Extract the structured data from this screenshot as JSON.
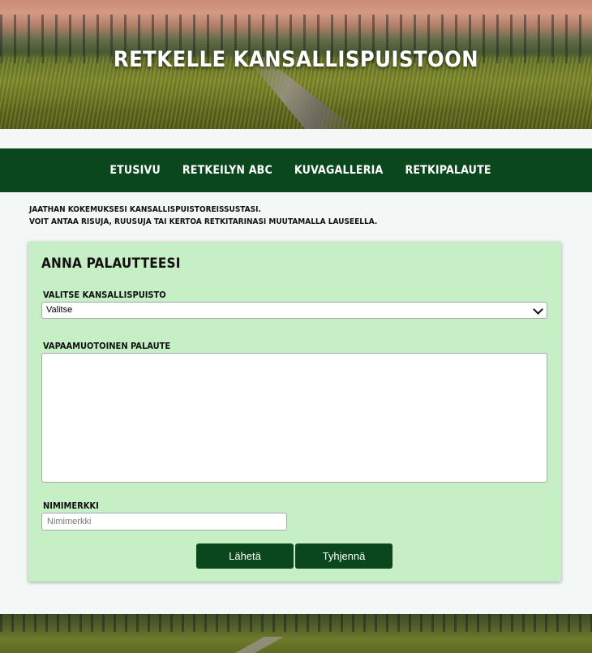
{
  "header": {
    "title": "RETKELLE KANSALLISPUISTOON"
  },
  "nav": {
    "items": [
      {
        "label": "ETUSIVU"
      },
      {
        "label": "RETKEILYN ABC"
      },
      {
        "label": "KUVAGALLERIA"
      },
      {
        "label": "RETKIPALAUTE"
      }
    ]
  },
  "intro": {
    "line1": "JAATHAN KOKEMUKSESI KANSALLISPUISTOREISSUSTASI.",
    "line2": "VOIT ANTAA RISUJA, RUUSUJA TAI KERTOA RETKITARINASI MUUTAMALLA LAUSEELLA."
  },
  "form": {
    "heading": "ANNA PALAUTTEESI",
    "park_label": "VALITSE KANSALLISPUISTO",
    "park_selected": "Valitse",
    "feedback_label": "VAPAAMUOTOINEN PALAUTE",
    "feedback_value": "",
    "nick_label": "NIMIMERKKI",
    "nick_placeholder": "Nimimerkki",
    "send_label": "Lähetä",
    "clear_label": "Tyhjennä"
  },
  "colors": {
    "nav_bg": "#0b471d",
    "card_bg": "#c6efc6",
    "button_bg": "#0b471d"
  }
}
